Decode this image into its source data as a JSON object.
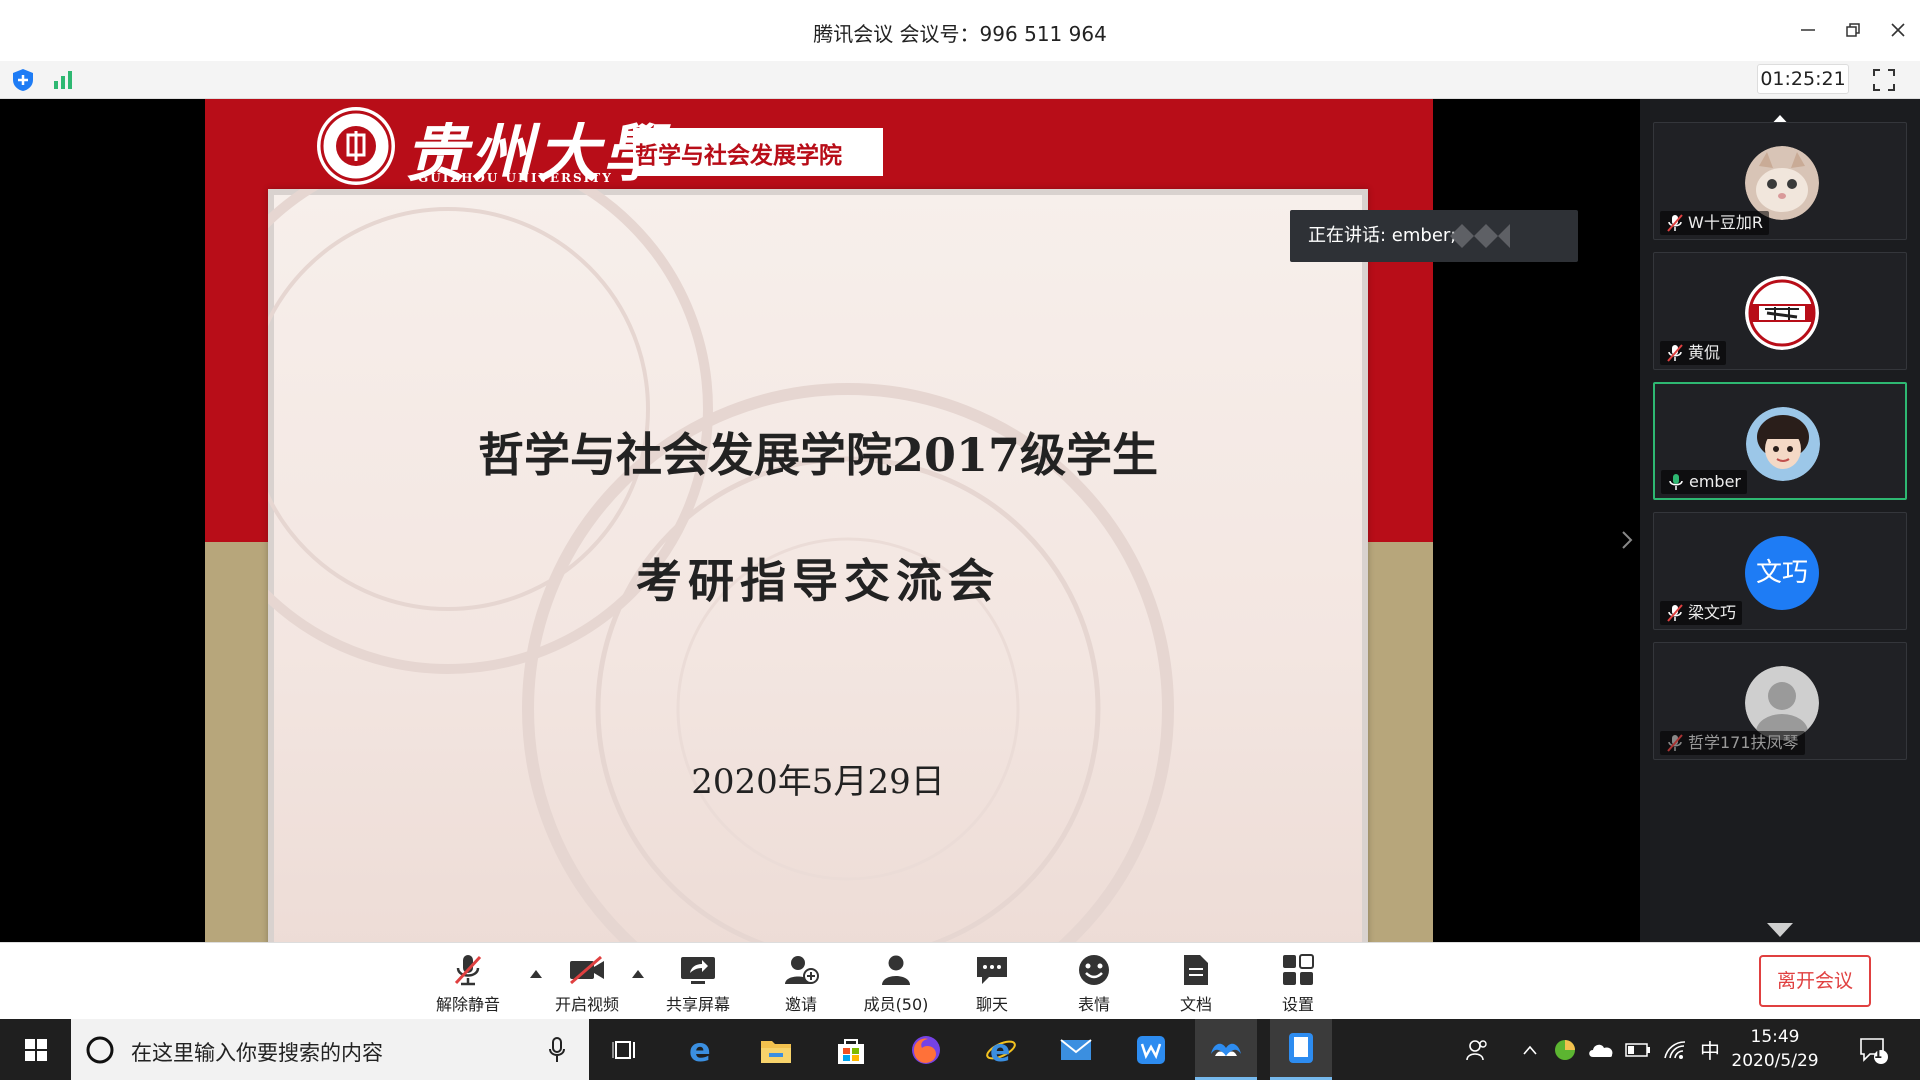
{
  "window": {
    "title": "腾讯会议 会议号：996 511 964",
    "timer": "01:25:21"
  },
  "slide": {
    "university_cn": "贵州大學",
    "university_en": "GUIZHOU UNIVERSITY",
    "department": "哲学与社会发展学院",
    "headline": "哲学与社会发展学院2017级学生",
    "subline": "考研指导交流会",
    "date": "2020年5月29日"
  },
  "speaking": {
    "label": "正在讲话: ember;"
  },
  "participants": [
    {
      "name": "W十豆加R",
      "mic": "muted",
      "avatar": "cat-photo-avatar"
    },
    {
      "name": "黄侃",
      "mic": "muted",
      "avatar": "yaode-logo-avatar"
    },
    {
      "name": "ember",
      "mic": "active",
      "avatar": "girl-photo-avatar"
    },
    {
      "name": "梁文巧",
      "mic": "muted",
      "avatar_text": "文巧",
      "avatar_color": "#1e7cf5"
    },
    {
      "name": "哲学171扶凤琴",
      "mic": "muted",
      "avatar": "default-person-avatar"
    }
  ],
  "toolbar": {
    "unmute": "解除静音",
    "video": "开启视频",
    "share": "共享屏幕",
    "invite": "邀请",
    "members": "成员(50)",
    "chat": "聊天",
    "emoji": "表情",
    "docs": "文档",
    "settings": "设置",
    "leave": "离开会议"
  },
  "taskbar": {
    "search_placeholder": "在这里输入你要搜索的内容",
    "ime": "中",
    "time": "15:49",
    "date": "2020/5/29",
    "notification_count": "1"
  },
  "colors": {
    "accent_red": "#e04040",
    "active_green": "#2eb872",
    "slide_red": "#b80d18",
    "slide_tan": "#b7a67b"
  }
}
